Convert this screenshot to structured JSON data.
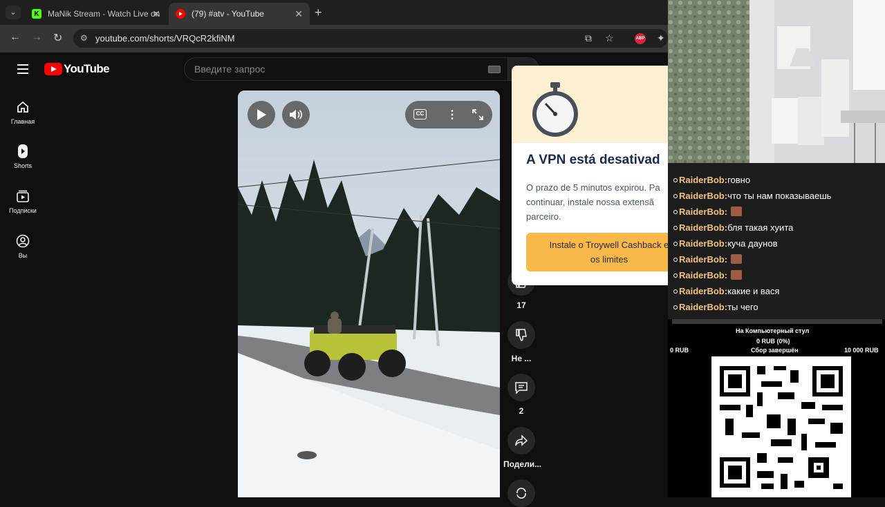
{
  "browser": {
    "tabs": [
      {
        "title": "MaNik Stream - Watch Live on",
        "favicon": "K"
      },
      {
        "title": "(79) #atv - YouTube",
        "favicon": "yt"
      }
    ],
    "address": "youtube.com/shorts/VRQcR2kfiNM",
    "extension_badge": "ABP"
  },
  "youtube": {
    "logo_text": "YouTube",
    "search_placeholder": "Введите запрос",
    "sidebar": [
      {
        "label": "Главная",
        "icon": "home-icon"
      },
      {
        "label": "Shorts",
        "icon": "shorts-icon"
      },
      {
        "label": "Подписки",
        "icon": "subscriptions-icon"
      },
      {
        "label": "Вы",
        "icon": "you-icon"
      }
    ],
    "actions": {
      "like_count": "17",
      "dislike_label": "Не ...",
      "comment_count": "2",
      "share_label": "Подели..."
    }
  },
  "vpn_popup": {
    "title": "A VPN está desativad",
    "body": "O prazo de 5 minutos expirou. Pa continuar, instale nossa extensã parceiro.",
    "body_lines": [
      "O prazo de 5 minutos expirou. Pa",
      "continuar, instale nossa extensã",
      "parceiro."
    ],
    "cta_lines": [
      "Instale o Troywell Cashback e",
      "os limites"
    ]
  },
  "chat": {
    "messages": [
      {
        "user": "RaiderBob:",
        "text": "говно",
        "emote": false
      },
      {
        "user": "RaiderBob:",
        "text": "что ты нам показываешь",
        "emote": false
      },
      {
        "user": "RaiderBob:",
        "text": "",
        "emote": true
      },
      {
        "user": "RaiderBob:",
        "text": "бля такая хуита",
        "emote": false
      },
      {
        "user": "RaiderBob:",
        "text": "куча даунов",
        "emote": false
      },
      {
        "user": "RaiderBob:",
        "text": "",
        "emote": true
      },
      {
        "user": "RaiderBob:",
        "text": "",
        "emote": true
      },
      {
        "user": "RaiderBob:",
        "text": "какие и вася",
        "emote": false
      },
      {
        "user": "RaiderBob:",
        "text": "ты чего",
        "emote": false
      }
    ]
  },
  "donation_goal": {
    "title": "На Компьютерный стул",
    "progress": "0 RUB (0%)",
    "progress_fraction": 0,
    "min": "0 RUB",
    "status": "Сбор завершён",
    "max": "10 000 RUB"
  }
}
